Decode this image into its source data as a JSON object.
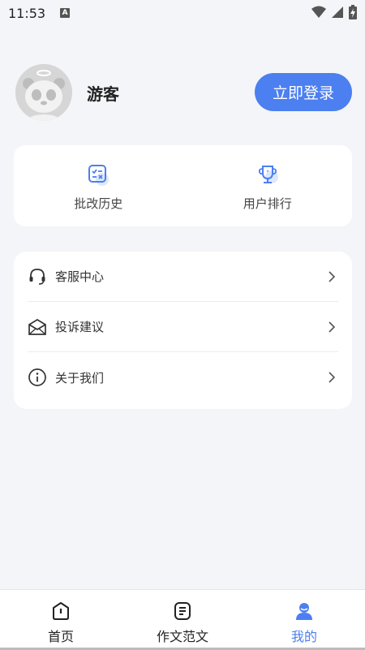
{
  "status_bar": {
    "time": "11:53",
    "indicator": "A"
  },
  "profile": {
    "name": "游客",
    "login_label": "立即登录"
  },
  "quick_actions": [
    {
      "label": "批改历史",
      "icon": "grading-history-icon"
    },
    {
      "label": "用户排行",
      "icon": "trophy-icon"
    }
  ],
  "menu": [
    {
      "label": "客服中心",
      "icon": "headset-icon"
    },
    {
      "label": "投诉建议",
      "icon": "mail-icon"
    },
    {
      "label": "关于我们",
      "icon": "info-icon"
    }
  ],
  "tabs": [
    {
      "label": "首页",
      "icon": "home-icon"
    },
    {
      "label": "作文范文",
      "icon": "essay-icon"
    },
    {
      "label": "我的",
      "icon": "user-icon",
      "active": true
    }
  ],
  "colors": {
    "accent": "#4c7ff0",
    "background": "#f4f5f8"
  }
}
